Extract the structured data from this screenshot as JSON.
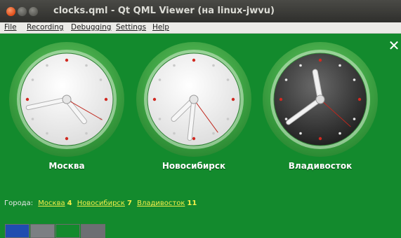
{
  "window": {
    "title": "clocks.qml - Qt QML Viewer (на linux-jwvu)",
    "buttons": [
      "close",
      "minimize",
      "maximize"
    ]
  },
  "menu": [
    {
      "label": "File"
    },
    {
      "label": "Recording"
    },
    {
      "label": "Debugging"
    },
    {
      "label": "Settings"
    },
    {
      "label": "Help"
    }
  ],
  "colors": {
    "background": "#138a2d",
    "link": "#f2ef4a",
    "second_hand": "#c0261c",
    "ring": "#4cae4e"
  },
  "quit_icon": "close-icon",
  "clocks": [
    {
      "city": "Москва",
      "face": "light",
      "hour": 4,
      "minute": 43,
      "second": 20
    },
    {
      "city": "Новосибирск",
      "face": "light",
      "hour": 7,
      "minute": 31,
      "second": 24
    },
    {
      "city": "Владивосток",
      "face": "dark",
      "hour": 11,
      "minute": 39,
      "second": 22
    }
  ],
  "citybar": {
    "prefix": "Города:",
    "items": [
      {
        "city": "Москва",
        "hour": "4"
      },
      {
        "city": "Новосибирск",
        "hour": "7"
      },
      {
        "city": "Владивосток",
        "hour": "11"
      }
    ]
  },
  "swatches": [
    {
      "color": "#1f4db0"
    },
    {
      "color": "#7c7f83"
    },
    {
      "color": "#138a2d"
    },
    {
      "color": "#6c6f73"
    }
  ]
}
